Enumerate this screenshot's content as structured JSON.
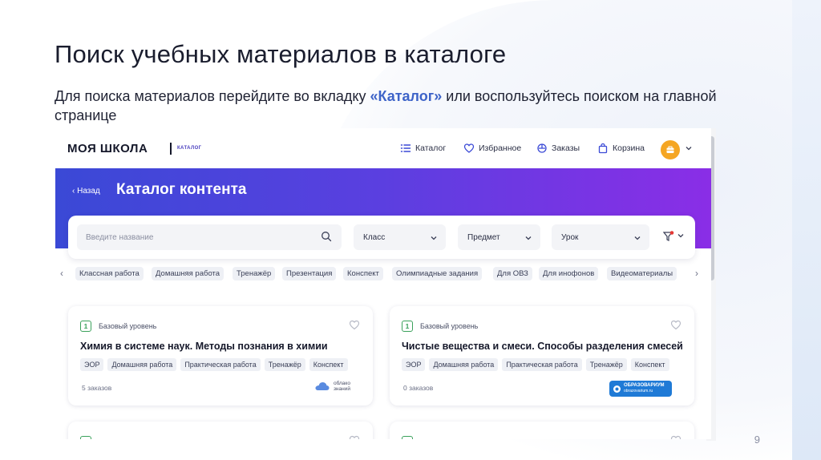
{
  "slide": {
    "title": "Поиск учебных материалов в каталоге",
    "desc_before": "Для поиска материалов перейдите во вкладку ",
    "desc_highlight": "«Каталог»",
    "desc_after": " или воспользуйтесь поиском на главной странице",
    "page_number": "9"
  },
  "header": {
    "logo": "МОЯ ШКОЛА",
    "logo_sub": "КАТАЛОГ",
    "nav": [
      {
        "label": "Каталог",
        "icon": "list-icon"
      },
      {
        "label": "Избранное",
        "icon": "heart-icon"
      },
      {
        "label": "Заказы",
        "icon": "orders-icon"
      },
      {
        "label": "Корзина",
        "icon": "bag-icon"
      }
    ]
  },
  "hero": {
    "back_label": "‹ Назад",
    "title": "Каталог контента"
  },
  "filters": {
    "search_placeholder": "Введите название",
    "class_label": "Класс",
    "subject_label": "Предмет",
    "lesson_label": "Урок"
  },
  "chips": [
    "Классная работа",
    "Домашняя работа",
    "Тренажёр",
    "Презентация",
    "Конспект",
    "Олимпиадные задания",
    "Для ОВЗ",
    "Для инофонов",
    "Видеоматериалы"
  ],
  "cards": [
    {
      "level_num": "1",
      "level": "Базовый уровень",
      "title": "Химия в системе наук. Методы познания в химии",
      "tags": [
        "ЭОР",
        "Домашняя работа",
        "Практическая работа",
        "Тренажёр",
        "Конспект"
      ],
      "orders": "5 заказов",
      "publisher_line1": "облако",
      "publisher_line2": "знаний"
    },
    {
      "level_num": "1",
      "level": "Базовый уровень",
      "title": "Чистые вещества и смеси. Способы разделения смесей",
      "tags": [
        "ЭОР",
        "Домашняя работа",
        "Практическая работа",
        "Тренажёр",
        "Конспект"
      ],
      "orders": "0 заказов",
      "publisher_line1": "ОБРАЗОВАРИУМ",
      "publisher_line2": "obrazovarium.ru"
    }
  ],
  "colors": {
    "hero_start": "#3a49d6",
    "hero_end": "#8a2ee6",
    "accent_link": "#3d63c8",
    "level_green": "#3aa15b",
    "avatar": "#f5a623"
  }
}
